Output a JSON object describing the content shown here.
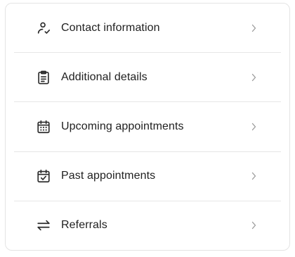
{
  "menu": {
    "items": [
      {
        "label": "Contact information",
        "icon": "user-check-icon"
      },
      {
        "label": "Additional details",
        "icon": "clipboard-list-icon"
      },
      {
        "label": "Upcoming appointments",
        "icon": "calendar-grid-icon"
      },
      {
        "label": "Past appointments",
        "icon": "calendar-check-icon"
      },
      {
        "label": "Referrals",
        "icon": "arrows-left-right-icon"
      }
    ],
    "chevron_icon": "chevron-right-icon"
  },
  "colors": {
    "text": "#1f1f1f",
    "icon": "#2b2b2b",
    "chevron": "#9a9a9a",
    "divider": "#e6e6e6",
    "border": "#e4e4e4",
    "background": "#ffffff"
  }
}
